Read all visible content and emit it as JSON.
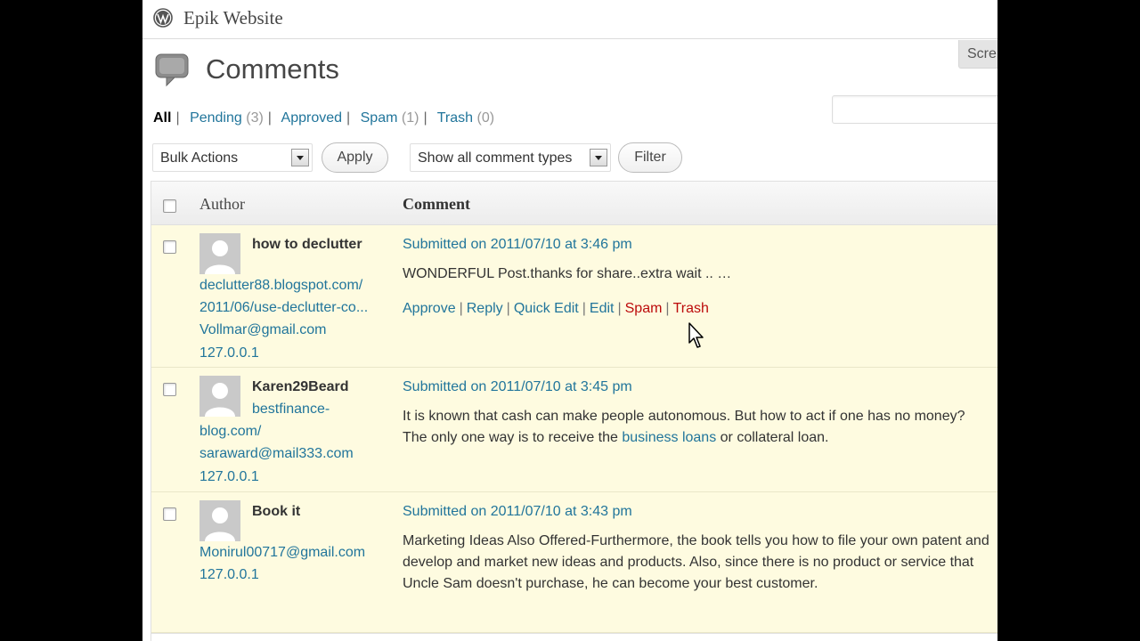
{
  "header": {
    "site_title": "Epik Website",
    "screen_options": "Scre"
  },
  "page": {
    "title": "Comments"
  },
  "filters": [
    {
      "label": "All",
      "count": "",
      "current": true
    },
    {
      "label": "Pending",
      "count": "(3)"
    },
    {
      "label": "Approved",
      "count": ""
    },
    {
      "label": "Spam",
      "count": "(1)"
    },
    {
      "label": "Trash",
      "count": "(0)"
    }
  ],
  "tablenav": {
    "bulk_actions": "Bulk Actions",
    "apply": "Apply",
    "comment_types": "Show all comment types",
    "filter": "Filter"
  },
  "columns": {
    "author": "Author",
    "comment": "Comment"
  },
  "rows": [
    {
      "author": "how to declutter",
      "url_line1": "declutter88.blogspot.com/",
      "url_line2": "2011/06/use-declutter-co...",
      "email": "Vollmar@gmail.com",
      "ip": "127.0.0.1",
      "submitted": "Submitted on 2011/07/10 at 3:46 pm",
      "text": "WONDERFUL Post.thanks for share..extra wait .. …",
      "actions": [
        "Approve",
        "Reply",
        "Quick Edit",
        "Edit",
        "Spam",
        "Trash"
      ]
    },
    {
      "author": "Karen29Beard",
      "url_line1": "bestfinance-",
      "url_line2": "blog.com/",
      "email": "saraward@mail333.com",
      "ip": "127.0.0.1",
      "submitted": "Submitted on 2011/07/10 at 3:45 pm",
      "text_part1": "It is known that cash can make people autonomous. But how to act if one has no money? The only one way is to receive the ",
      "text_link": "business loans",
      "text_part2": " or collateral loan."
    },
    {
      "author": "Book it",
      "email": "Monirul00717@gmail.com",
      "ip": "127.0.0.1",
      "submitted": "Submitted on 2011/07/10 at 3:43 pm",
      "text": "Marketing Ideas Also Offered-Furthermore, the book tells you how to file your own patent and develop and market new ideas and products. Also, since there is no product or service that Uncle Sam doesn't purchase, he can become your best customer."
    }
  ],
  "colors": {
    "link": "#21759b",
    "warn": "#bc0b0b",
    "row_bg": "#fefbe0"
  },
  "icons": [
    "wordpress-logo-icon",
    "comments-page-icon",
    "chevron-down-icon",
    "mouse-cursor-icon"
  ]
}
